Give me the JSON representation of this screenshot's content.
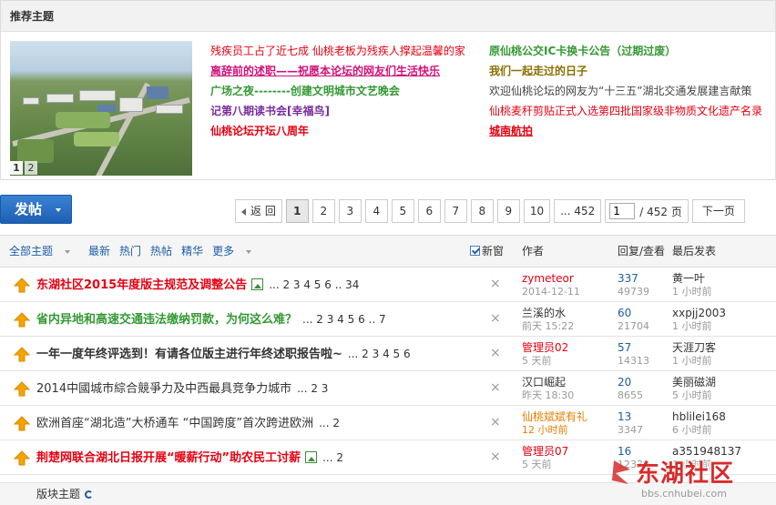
{
  "recommended": {
    "header": "推荐主题",
    "thumb_pages": [
      "1",
      "2"
    ],
    "col_a": [
      {
        "text": "残疾员工占了近七成 仙桃老板为残疾人撑起温馨的家",
        "style": "c-red"
      },
      {
        "text": "离辞前的述职——祝愿本论坛的网友们生活快乐",
        "style": "c-magenta"
      },
      {
        "text": "广场之夜--------创建文明城市文艺晚会",
        "style": "c-green"
      },
      {
        "text": "记第八期读书会[幸福鸟]",
        "style": "c-purple"
      },
      {
        "text": "仙桃论坛开坛八周年",
        "style": "c-redb"
      }
    ],
    "col_b": [
      {
        "text": "原仙桃公交IC卡换卡公告（过期过废）",
        "style": "c-green"
      },
      {
        "text": "我们一起走过的日子",
        "style": "c-olive"
      },
      {
        "text": "欢迎仙桃论坛的网友为“十三五”湖北交通发展建言献策",
        "style": "c-gray"
      },
      {
        "text": "仙桃麦秆剪贴正式入选第四批国家级非物质文化遗产名录",
        "style": "c-red"
      },
      {
        "text": "城南航拍",
        "style": "c-redu"
      }
    ]
  },
  "toolbar": {
    "post_label": "发帖",
    "back_label": "返 回",
    "pages": [
      "1",
      "2",
      "3",
      "4",
      "5",
      "6",
      "7",
      "8",
      "9",
      "10"
    ],
    "last_page_label": "... 452",
    "jump_value": "1",
    "jump_total": "/ 452 页",
    "next_label": "下一页"
  },
  "thread_header": {
    "filters": [
      "全部主题",
      "最新",
      "热门",
      "热帖",
      "精华",
      "更多"
    ],
    "new_window": "新窗",
    "col_author": "作者",
    "col_reply": "回复/查看",
    "col_last": "最后发表"
  },
  "threads": [
    {
      "title": "东湖社区2015年度版主规范及调整公告",
      "style": "red",
      "has_img": true,
      "pages": "... 2 3 4 5 6 .. 34",
      "author": "zymeteor",
      "author_style": "red",
      "date": "2014-12-11",
      "date_style": "",
      "replies": "337",
      "views": "49739",
      "last_user": "黄一叶",
      "last_time": "1 小时前"
    },
    {
      "title": "省内异地和高速交通违法缴纳罚款，为何这么难？",
      "style": "green",
      "has_img": false,
      "pages": "... 2 3 4 5 6 .. 7",
      "author": "兰溪的水",
      "author_style": "dark",
      "date": "前天 15:22",
      "date_style": "",
      "replies": "60",
      "views": "21704",
      "last_user": "xxpjj2003",
      "last_time": "1 小时前"
    },
    {
      "title": "一年一度年终评选到！有请各位版主进行年终述职报告啦~",
      "style": "dark",
      "has_img": false,
      "pages": "... 2 3 4 5 6",
      "author": "管理员02",
      "author_style": "red",
      "date": "5 天前",
      "date_style": "",
      "replies": "57",
      "views": "14313",
      "last_user": "天涯刀客",
      "last_time": "1 小时前"
    },
    {
      "title": "2014中國城市綜合競爭力及中西最具竞争力城市",
      "style": "norm",
      "has_img": false,
      "pages": "... 2 3",
      "author": "汉口崛起",
      "author_style": "dark",
      "date": "昨天 18:30",
      "date_style": "",
      "replies": "20",
      "views": "8655",
      "last_user": "美丽磁湖",
      "last_time": "5 小时前"
    },
    {
      "title": "欧洲首座“湖北造”大桥通车 “中国跨度”首次跨进欧洲",
      "style": "norm",
      "has_img": false,
      "pages": "... 2",
      "author": "仙桃斌斌有礼",
      "author_style": "orange",
      "date": "12 小时前",
      "date_style": "orange",
      "replies": "13",
      "views": "3347",
      "last_user": "hblilei168",
      "last_time": "6 小时前"
    },
    {
      "title": "荆楚网联合湖北日报开展“暖薪行动”助农民工讨薪",
      "style": "red",
      "has_img": true,
      "pages": "... 2",
      "author": "管理员07",
      "author_style": "red",
      "date": "5 天前",
      "date_style": "",
      "replies": "16",
      "views": "12330",
      "last_user": "a351948137",
      "last_time": "1 小时前"
    }
  ],
  "footer": {
    "label": "版块主题"
  },
  "watermark": {
    "brand": "东湖社区",
    "url": "bbs.cnhubei.com"
  },
  "colors": {
    "accent_blue": "#1c5ea8",
    "post_button": "#2a6fc6",
    "title_red": "#e60012",
    "title_green": "#339933"
  }
}
